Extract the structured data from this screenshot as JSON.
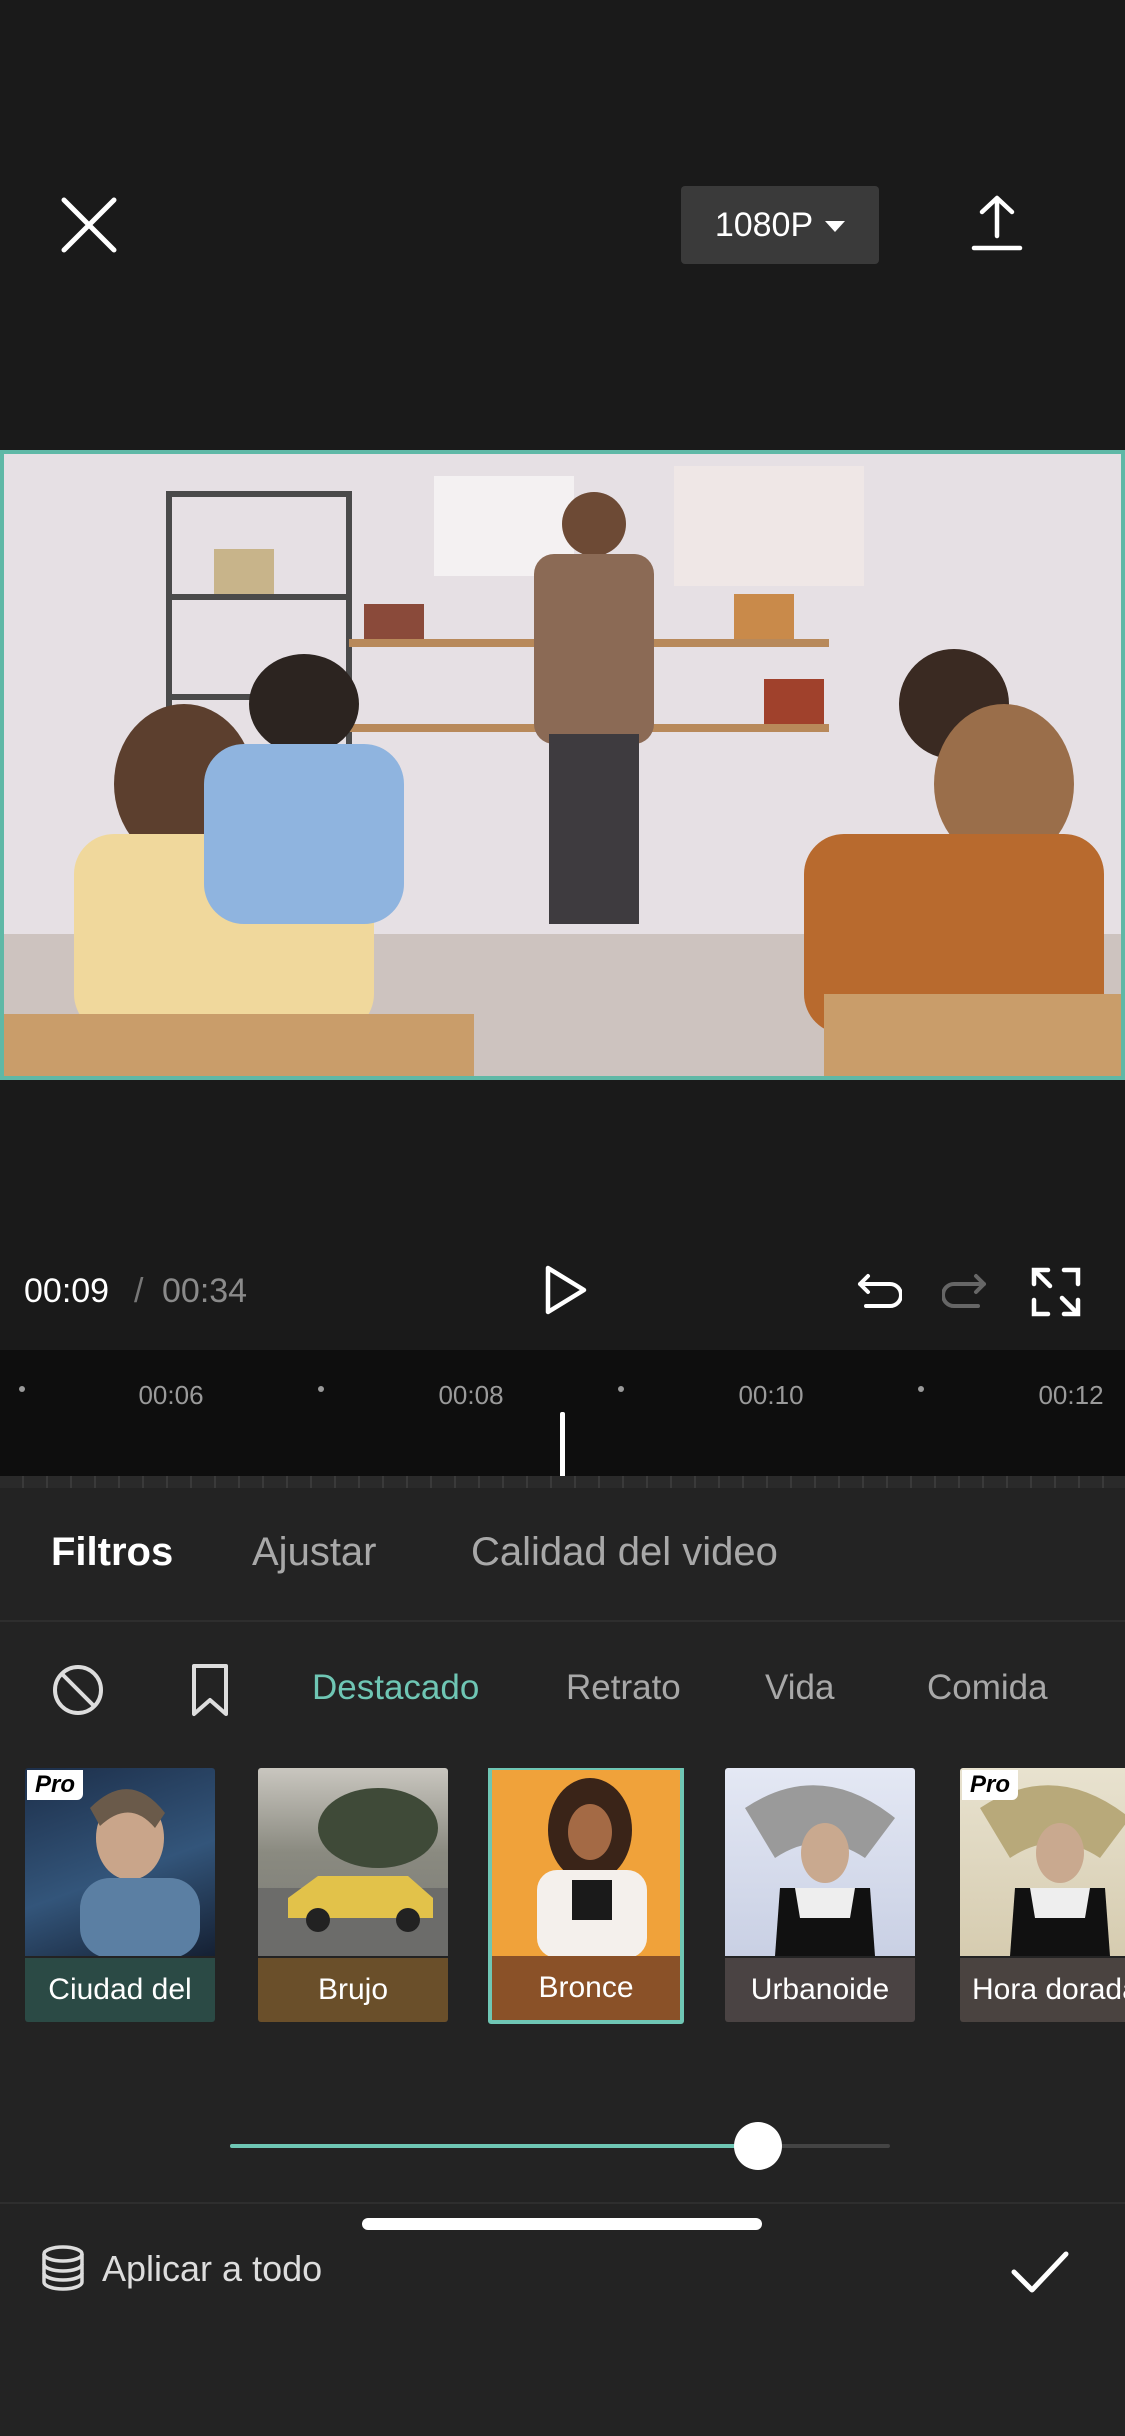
{
  "header": {
    "resolution_label": "1080P",
    "close_icon": "close-icon",
    "export_icon": "export-icon"
  },
  "player": {
    "current_time": "00:09",
    "separator": "/",
    "total_time": "00:34"
  },
  "timeline": {
    "ticks": [
      "00:06",
      "00:08",
      "00:10",
      "00:12"
    ]
  },
  "tabs": [
    {
      "label": "Filtros",
      "active": true
    },
    {
      "label": "Ajustar",
      "active": false
    },
    {
      "label": "Calidad del video",
      "active": false
    }
  ],
  "categories": [
    {
      "label": "Destacado",
      "active": true
    },
    {
      "label": "Retrato",
      "active": false
    },
    {
      "label": "Vida",
      "active": false
    },
    {
      "label": "Comida",
      "active": false
    }
  ],
  "filters": [
    {
      "label": "Ciudad del",
      "pro": "Pro",
      "selected": false
    },
    {
      "label": "Brujo",
      "selected": false
    },
    {
      "label": "Bronce",
      "selected": true
    },
    {
      "label": "Urbanoide",
      "selected": false
    },
    {
      "label": "Hora dorada",
      "pro": "Pro",
      "selected": false
    }
  ],
  "intensity": {
    "value": 0.8
  },
  "footer": {
    "apply_all_label": "Aplicar a todo"
  },
  "colors": {
    "accent": "#6fc6b4",
    "background": "#1a1a1a",
    "panel": "#232323"
  }
}
